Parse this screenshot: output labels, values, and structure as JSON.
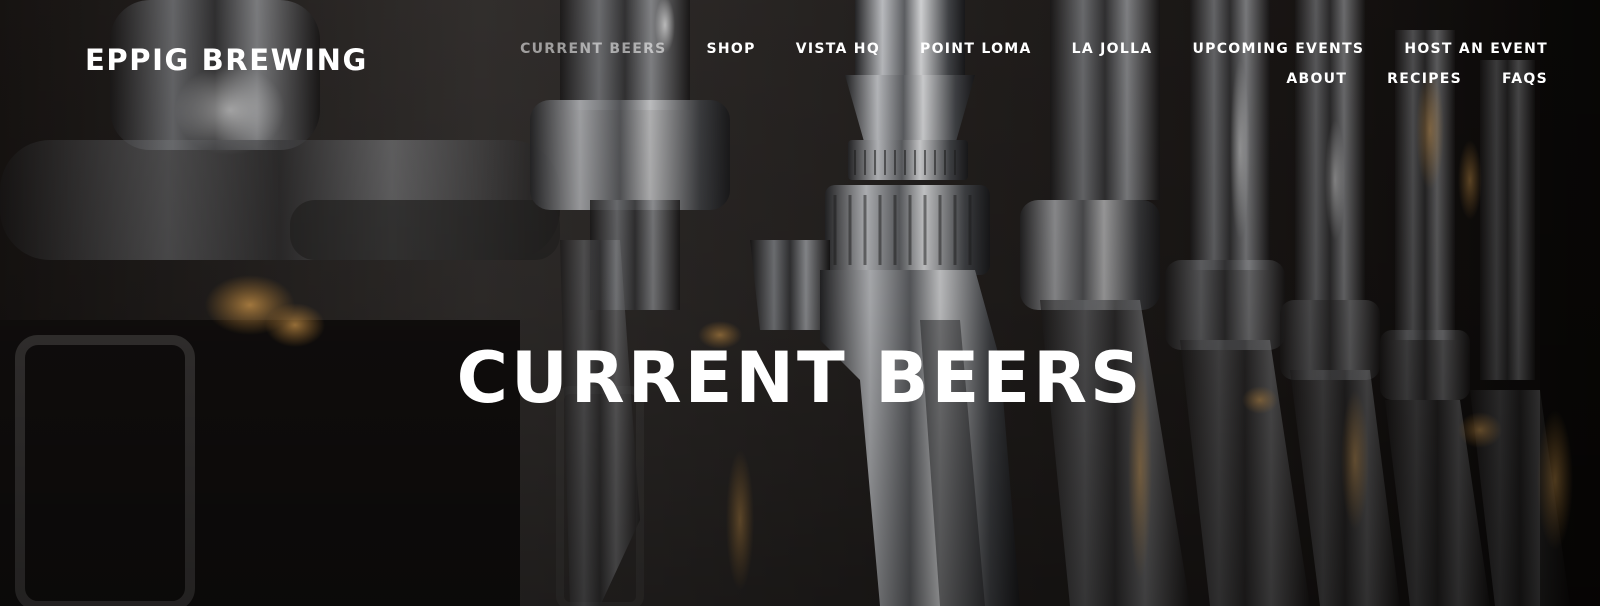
{
  "site": {
    "title": "EPPIG BREWING"
  },
  "nav": {
    "row1": [
      {
        "label": "CURRENT BEERS",
        "active": true
      },
      {
        "label": "SHOP"
      },
      {
        "label": "VISTA HQ"
      },
      {
        "label": "POINT LOMA"
      },
      {
        "label": "LA JOLLA"
      },
      {
        "label": "UPCOMING EVENTS"
      },
      {
        "label": "HOST AN EVENT"
      }
    ],
    "row2": [
      {
        "label": "ABOUT"
      },
      {
        "label": "RECIPES"
      },
      {
        "label": "FAQS"
      }
    ]
  },
  "hero": {
    "heading": "CURRENT BEERS",
    "background_description_colors": {
      "dark": "#0b0908",
      "steel": "#b9bcc0",
      "warm_glow": "#e09a3c"
    }
  }
}
